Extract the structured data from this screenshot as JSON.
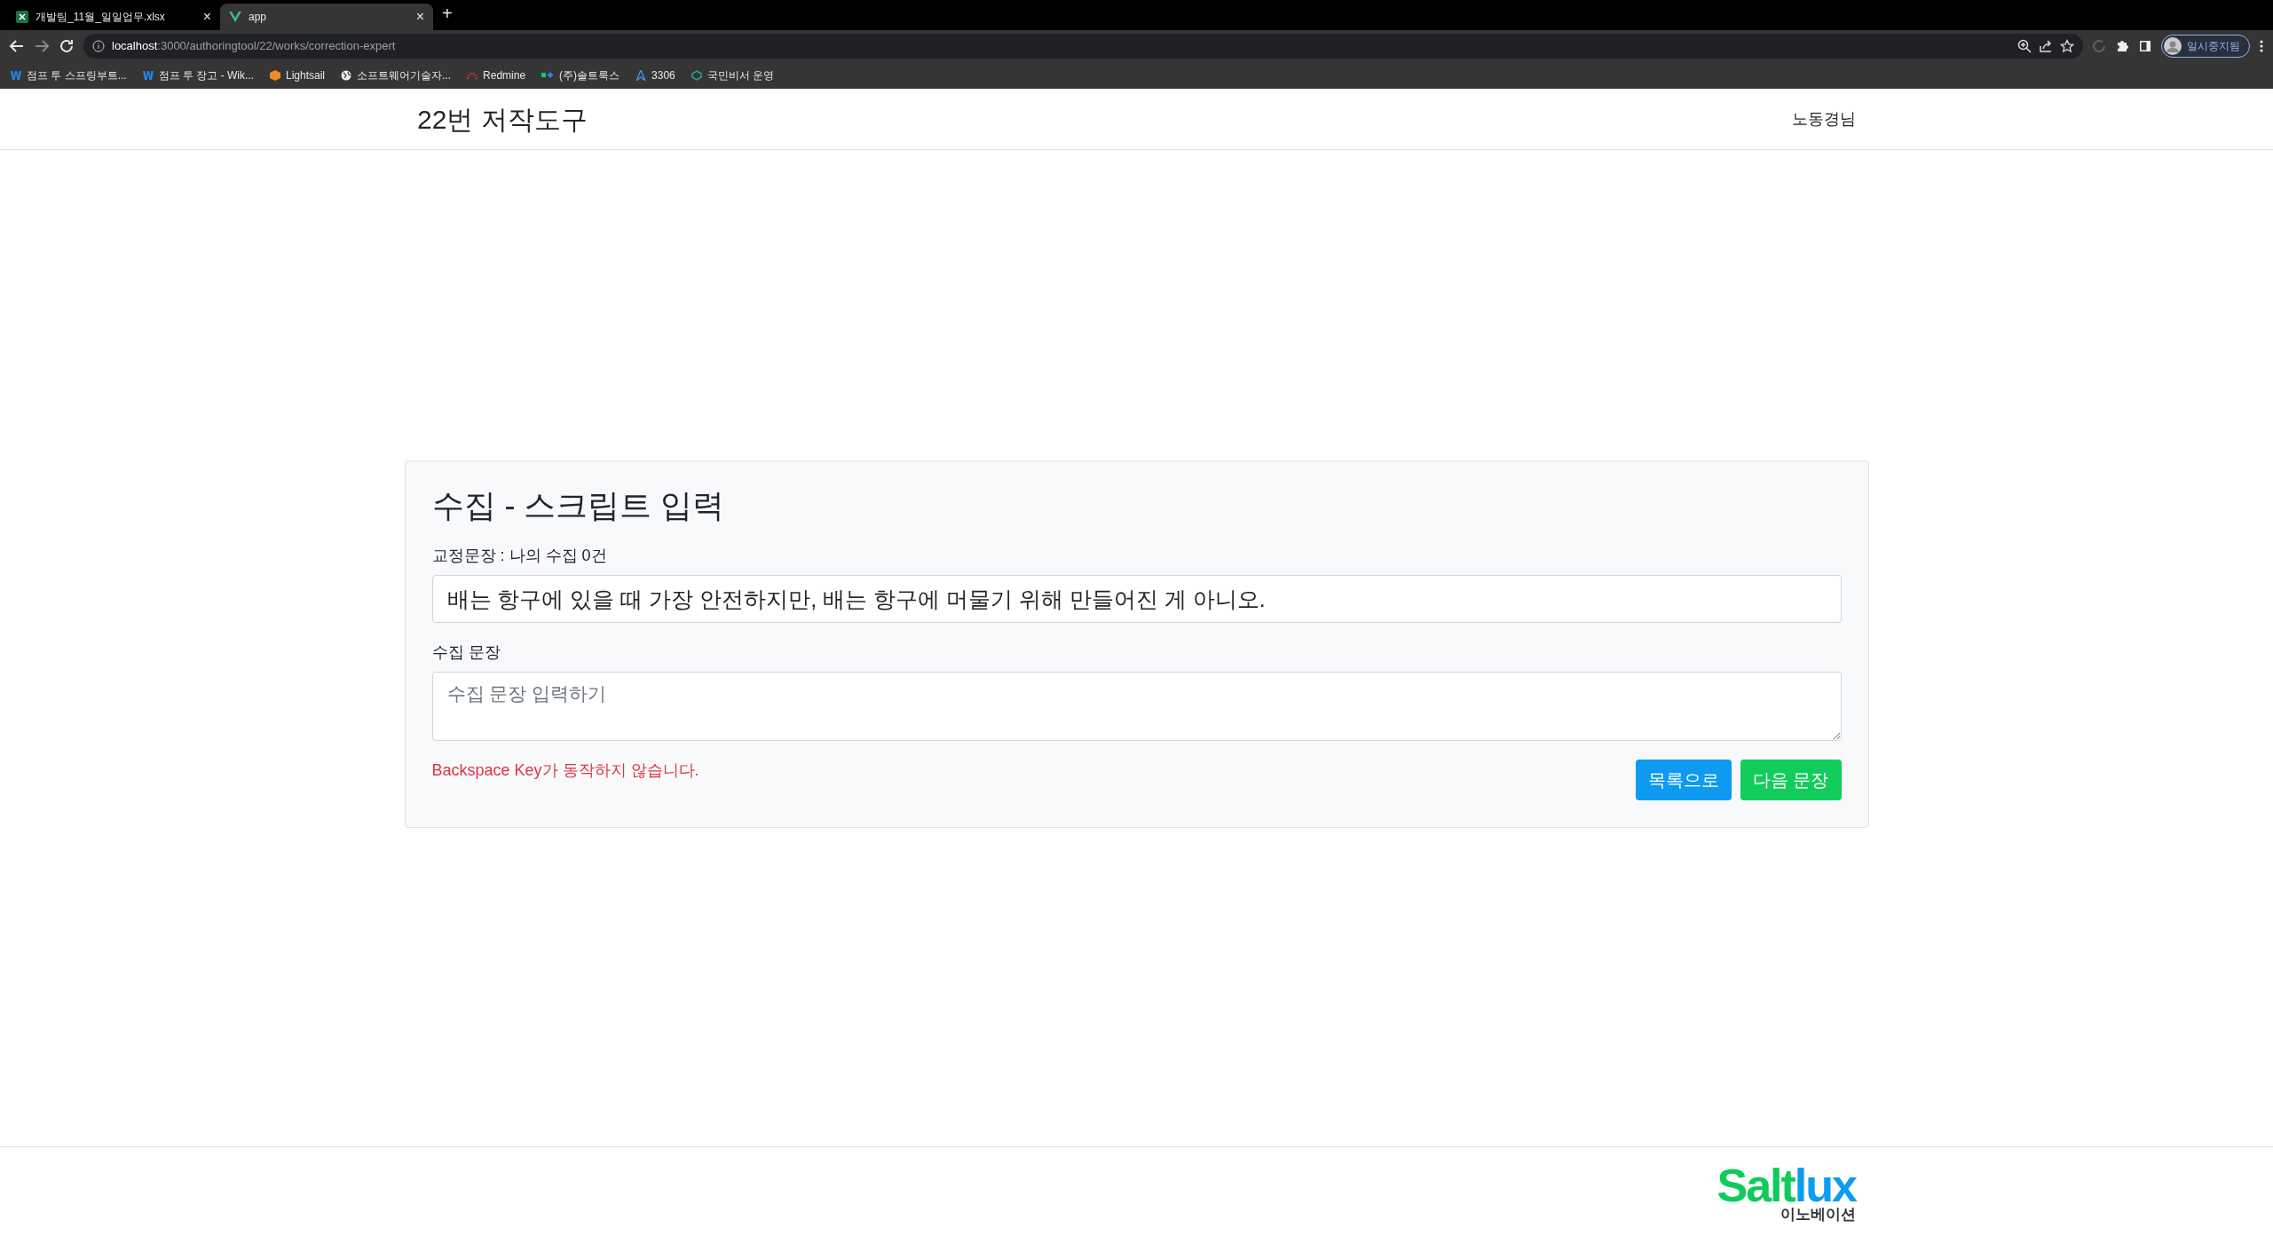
{
  "browser": {
    "tabs": [
      {
        "title": "개발팀_11월_일일업무.xlsx",
        "selected": false,
        "close": "×"
      },
      {
        "title": "app",
        "selected": true,
        "close": "×"
      }
    ],
    "new_tab": "+",
    "address": {
      "host": "localhost",
      "path": ":3000/authoringtool/22/works/correction-expert"
    },
    "profile": "일시중지됨",
    "bookmarks": [
      {
        "label": "점프 투 스프링부트..."
      },
      {
        "label": "점프 투 장고 - Wik..."
      },
      {
        "label": "Lightsail"
      },
      {
        "label": "소프트웨어기술자..."
      },
      {
        "label": "Redmine"
      },
      {
        "label": "(주)솔트룩스"
      },
      {
        "label": "3306"
      },
      {
        "label": "국민비서 운영"
      }
    ]
  },
  "header": {
    "title": "22번 저작도구",
    "user": "노동경님"
  },
  "card": {
    "title": "수집 - 스크립트 입력",
    "reference_label": "교정문장 : 나의 수집 0건",
    "reference_sentence": "배는 항구에 있을 때 가장 안전하지만, 배는 항구에 머물기 위해 만들어진 게 아니오.",
    "input_label": "수집 문장",
    "input_placeholder": "수집 문장 입력하기",
    "warning": "Backspace Key가 동작하지 않습니다.",
    "buttons": [
      {
        "label": "목록으로",
        "kind": "primary"
      },
      {
        "label": "다음 문장",
        "kind": "success"
      }
    ]
  },
  "footer": {
    "logo_left": "Salt",
    "logo_right": "lux",
    "logo_sub": "이노베이션"
  }
}
